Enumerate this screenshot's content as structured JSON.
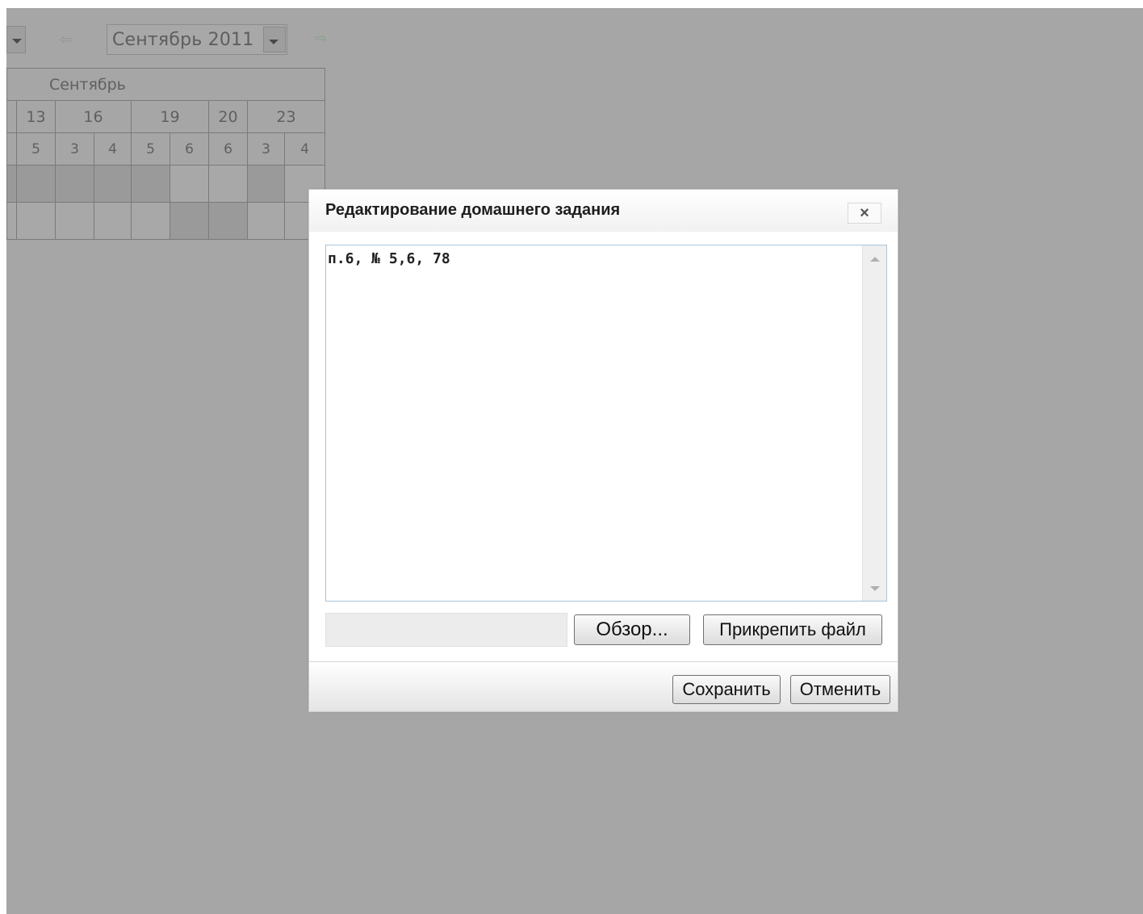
{
  "toolbar": {
    "month_select_value": "Сентябрь 2011",
    "prev_icon": "arrow-left-icon",
    "next_icon": "arrow-right-icon"
  },
  "calendar": {
    "month_label": "Сентябрь",
    "dates": [
      "13",
      "16",
      "19",
      "20",
      "23"
    ],
    "lesson_numbers": [
      "5",
      "3",
      "4",
      "5",
      "6",
      "6",
      "3",
      "4"
    ]
  },
  "dialog": {
    "title": "Редактирование домашнего задания",
    "close_label": "×",
    "homework_text": "п.6, № 5,6, 78",
    "browse_label": "Обзор...",
    "attach_label": "Прикрепить файл",
    "save_label": "Сохранить",
    "cancel_label": "Отменить"
  },
  "colors": {
    "overlay": "#a6a6a6",
    "dialog_bg": "#ffffff",
    "nav_arrow": "#8aa08a"
  }
}
